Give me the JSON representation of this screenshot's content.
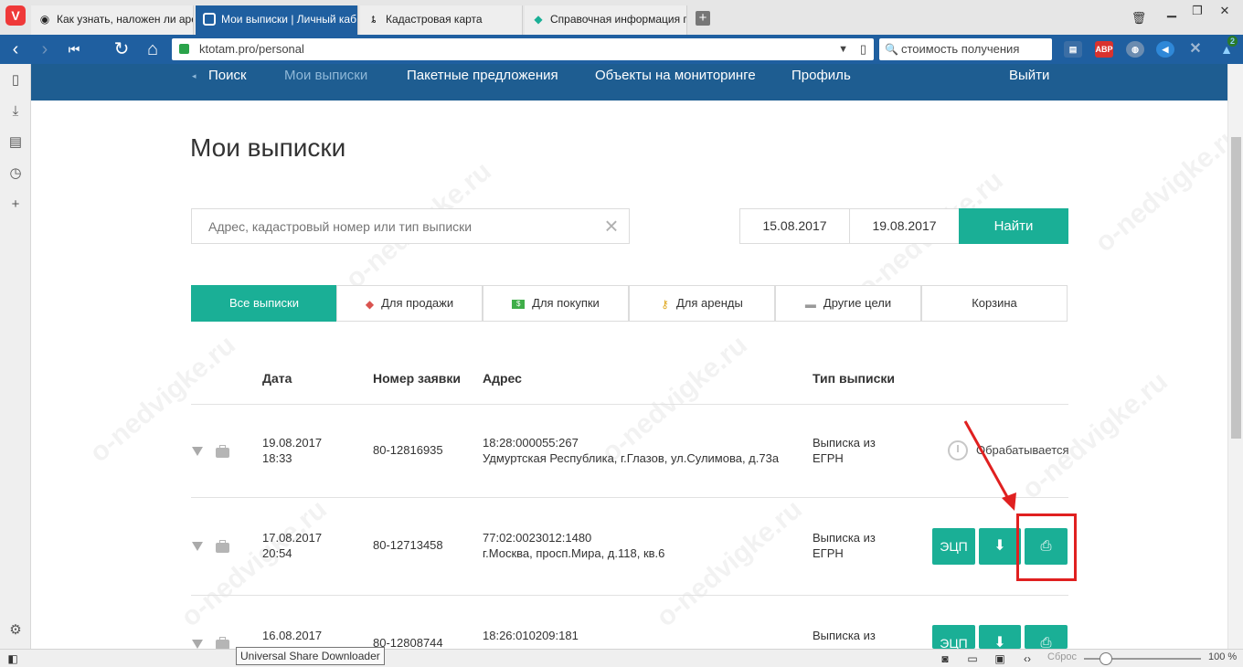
{
  "browser": {
    "tabs": [
      {
        "title": "Как узнать, наложен ли аре",
        "icon": "globe-icon"
      },
      {
        "title": "Мои выписки | Личный каб",
        "icon": "site-icon"
      },
      {
        "title": "Кадастровая карта",
        "icon": "pin-icon"
      },
      {
        "title": "Справочная информация п",
        "icon": "map-icon"
      }
    ],
    "url": "ktotam.pro/personal",
    "search_value": "стоимость получения",
    "extensions": {
      "abp": "ABP",
      "badge": "2"
    },
    "tooltip": "Universal Share Downloader",
    "zoom": {
      "reset_label": "Сброс",
      "value": "100 %"
    }
  },
  "site_nav": {
    "items": [
      "Поиск",
      "Мои выписки",
      "Пакетные предложения",
      "Объекты на мониторинге",
      "Профиль"
    ],
    "logout": "Выйти"
  },
  "page": {
    "title": "Мои выписки",
    "search_placeholder": "Адрес, кадастровый номер или тип выписки",
    "date_from": "15.08.2017",
    "date_to": "19.08.2017",
    "find_label": "Найти",
    "filter_tabs": [
      {
        "label": "Все выписки",
        "icon": ""
      },
      {
        "label": "Для продажи",
        "icon": "tag-icon"
      },
      {
        "label": "Для покупки",
        "icon": "money-icon"
      },
      {
        "label": "Для аренды",
        "icon": "key-icon"
      },
      {
        "label": "Другие цели",
        "icon": "briefcase-icon"
      },
      {
        "label": "Корзина",
        "icon": ""
      }
    ]
  },
  "table": {
    "columns": [
      "Дата",
      "Номер заявки",
      "Адрес",
      "Тип выписки"
    ],
    "rows": [
      {
        "date": "19.08.2017",
        "time": "18:33",
        "number": "80-12816935",
        "cadastral": "18:28:000055:267",
        "address": "Удмуртская Республика, г.Глазов, ул.Сулимова, д.73а",
        "type_line1": "Выписка из",
        "type_line2": "ЕГРН",
        "status": "Обрабатывается"
      },
      {
        "date": "17.08.2017",
        "time": "20:54",
        "number": "80-12713458",
        "cadastral": "77:02:0023012:1480",
        "address": "г.Москва, просп.Мира, д.118, кв.6",
        "type_line1": "Выписка из",
        "type_line2": "ЕГРН",
        "ecp_label": "ЭЦП"
      },
      {
        "date": "16.08.2017",
        "time": "",
        "number": "80-12808744",
        "cadastral": "18:26:010209:181",
        "address": "",
        "type_line1": "Выписка из",
        "type_line2": "",
        "ecp_label": "ЭЦП"
      }
    ]
  },
  "colors": {
    "accent": "#1aaf96",
    "nav": "#1e5d91",
    "browser": "#1f5fa0",
    "highlight": "#e02020"
  }
}
